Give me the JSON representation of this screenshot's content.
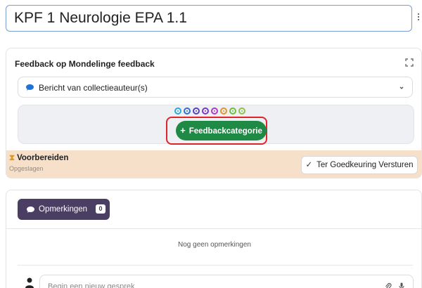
{
  "title_value": "KPF 1 Neurologie EPA 1.1",
  "feedback_card": {
    "header": "Feedback op Mondelinge feedback",
    "selector_label": "Bericht van collectieauteur(s)",
    "add_category_label": "Feedbackcategorie",
    "dot_colors": [
      "#27a9e1",
      "#2f6fd6",
      "#5a3fc0",
      "#7a39c6",
      "#b13ac2",
      "#e3932b",
      "#6fbf3b",
      "#8bc34a"
    ]
  },
  "status": {
    "title": "Voorbereiden",
    "subtitle": "Opgeslagen",
    "submit_label": "Ter Goedkeuring Versturen"
  },
  "comments": {
    "tab_label": "Opmerkingen",
    "count": "0",
    "empty_message": "Nog geen opmerkingen",
    "input_placeholder": "Begin een nieuw gesprek"
  },
  "colors": {
    "primary_green": "#1e8a46",
    "tab_purple": "#4a3f63",
    "status_bg": "#f6e0c9",
    "highlight_red": "#e0242a"
  }
}
